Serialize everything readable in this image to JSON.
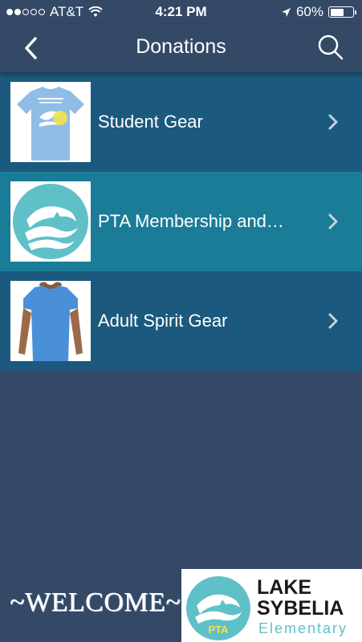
{
  "status_bar": {
    "carrier": "AT&T",
    "time": "4:21 PM",
    "battery_percent": "60%",
    "battery_level": 0.6,
    "signal_bars_filled": 2,
    "signal_bars_total": 5
  },
  "nav": {
    "title": "Donations",
    "back_icon": "chevron-left-icon",
    "search_icon": "search-icon"
  },
  "items": [
    {
      "label": "Student Gear",
      "thumbnail": "lake-sybelia-tshirt"
    },
    {
      "label": "PTA Membership and…",
      "thumbnail": "dolphin-logo"
    },
    {
      "label": "Adult Spirit Gear",
      "thumbnail": "blue-womens-tshirt"
    }
  ],
  "footer": {
    "welcome_text": "~WELCOME~",
    "logo_line1": "LAKE",
    "logo_line2": "SYBELIA",
    "logo_line3": "Elementary",
    "logo_badge": "PTA"
  },
  "colors": {
    "background": "#344966",
    "row_dark": "#1b5a7e",
    "row_active": "#1b7c98",
    "teal": "#5fc0c8"
  }
}
